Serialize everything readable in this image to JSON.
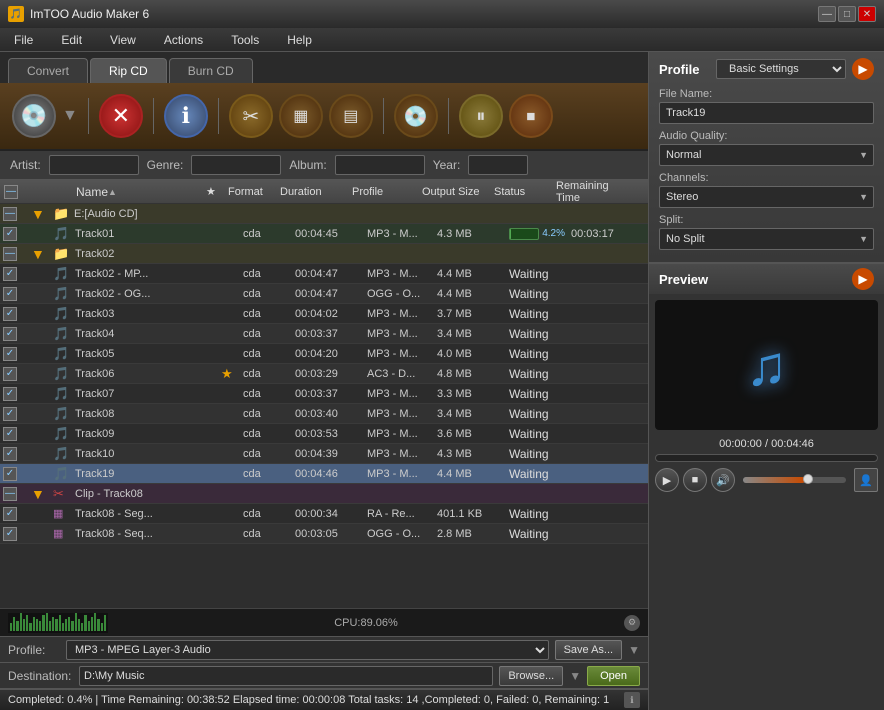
{
  "app": {
    "title": "ImTOO Audio Maker 6",
    "icon": "🎵"
  },
  "title_controls": {
    "minimize": "—",
    "maximize": "□",
    "close": "✕"
  },
  "menu": {
    "items": [
      "File",
      "Edit",
      "View",
      "Actions",
      "Tools",
      "Help"
    ]
  },
  "tabs": {
    "convert": "Convert",
    "rip_cd": "Rip CD",
    "burn_cd": "Burn CD",
    "active": "rip_cd"
  },
  "toolbar": {
    "buttons": [
      {
        "id": "disc",
        "label": "💿",
        "title": "Open Disc"
      },
      {
        "id": "delete",
        "label": "✕",
        "title": "Delete"
      },
      {
        "id": "info",
        "label": "ℹ",
        "title": "Info"
      },
      {
        "id": "scissors",
        "label": "✂",
        "title": "Cut"
      },
      {
        "id": "strip",
        "label": "🎞",
        "title": "Strip"
      },
      {
        "id": "film",
        "label": "🎬",
        "title": "Film"
      },
      {
        "id": "cd",
        "label": "💿",
        "title": "CD"
      },
      {
        "id": "pause",
        "label": "⏸",
        "title": "Pause"
      },
      {
        "id": "stop",
        "label": "⏹",
        "title": "Stop"
      }
    ]
  },
  "meta": {
    "artist_label": "Artist:",
    "artist_value": "",
    "genre_label": "Genre:",
    "genre_value": "",
    "album_label": "Album:",
    "album_value": "",
    "year_label": "Year:",
    "year_value": ""
  },
  "list_headers": {
    "check": "",
    "icon1": "",
    "icon2": "",
    "name": "Name",
    "star": "",
    "format": "Format",
    "duration": "Duration",
    "profile": "Profile",
    "output_size": "Output Size",
    "status": "Status",
    "remaining": "Remaining Time"
  },
  "file_list": {
    "items": [
      {
        "id": "drive",
        "indent": 0,
        "type": "drive",
        "name": "E:[Audio CD]",
        "format": "",
        "duration": "",
        "profile": "",
        "output_size": "",
        "status": "",
        "remaining": "",
        "checked": "partial"
      },
      {
        "id": "track01",
        "indent": 1,
        "type": "track",
        "name": "Track01",
        "format": "cda",
        "duration": "00:04:45",
        "profile": "MP3 - M...",
        "output_size": "4.3 MB",
        "status": "4.2%",
        "remaining": "00:03:17",
        "checked": "checked",
        "progress": 4.2
      },
      {
        "id": "group1",
        "indent": 1,
        "type": "group",
        "name": "Track02",
        "format": "",
        "duration": "",
        "profile": "",
        "output_size": "",
        "status": "",
        "remaining": "",
        "checked": "partial"
      },
      {
        "id": "track02mp3",
        "indent": 2,
        "type": "track",
        "name": "Track02 - MP...",
        "format": "cda",
        "duration": "00:04:47",
        "profile": "MP3 - M...",
        "output_size": "4.4 MB",
        "status": "Waiting",
        "remaining": "",
        "checked": "checked"
      },
      {
        "id": "track02ogg",
        "indent": 2,
        "type": "track",
        "name": "Track02 - OG...",
        "format": "cda",
        "duration": "00:04:47",
        "profile": "OGG - O...",
        "output_size": "4.4 MB",
        "status": "Waiting",
        "remaining": "",
        "checked": "checked"
      },
      {
        "id": "track03",
        "indent": 1,
        "type": "track",
        "name": "Track03",
        "format": "cda",
        "duration": "00:04:02",
        "profile": "MP3 - M...",
        "output_size": "3.7 MB",
        "status": "Waiting",
        "remaining": "",
        "checked": "checked"
      },
      {
        "id": "track04",
        "indent": 1,
        "type": "track",
        "name": "Track04",
        "format": "cda",
        "duration": "00:03:37",
        "profile": "MP3 - M...",
        "output_size": "3.4 MB",
        "status": "Waiting",
        "remaining": "",
        "checked": "checked"
      },
      {
        "id": "track05",
        "indent": 1,
        "type": "track",
        "name": "Track05",
        "format": "cda",
        "duration": "00:04:20",
        "profile": "MP3 - M...",
        "output_size": "4.0 MB",
        "status": "Waiting",
        "remaining": "",
        "checked": "checked"
      },
      {
        "id": "track06",
        "indent": 1,
        "type": "track",
        "name": "Track06",
        "format": "cda",
        "duration": "00:03:29",
        "profile": "AC3 - D...",
        "output_size": "4.8 MB",
        "status": "Waiting",
        "remaining": "",
        "checked": "checked",
        "star": true
      },
      {
        "id": "track07",
        "indent": 1,
        "type": "track",
        "name": "Track07",
        "format": "cda",
        "duration": "00:03:37",
        "profile": "MP3 - M...",
        "output_size": "3.3 MB",
        "status": "Waiting",
        "remaining": "",
        "checked": "checked"
      },
      {
        "id": "track08",
        "indent": 1,
        "type": "track",
        "name": "Track08",
        "format": "cda",
        "duration": "00:03:40",
        "profile": "MP3 - M...",
        "output_size": "3.4 MB",
        "status": "Waiting",
        "remaining": "",
        "checked": "checked"
      },
      {
        "id": "track09",
        "indent": 1,
        "type": "track",
        "name": "Track09",
        "format": "cda",
        "duration": "00:03:53",
        "profile": "MP3 - M...",
        "output_size": "3.6 MB",
        "status": "Waiting",
        "remaining": "",
        "checked": "checked"
      },
      {
        "id": "track10",
        "indent": 1,
        "type": "track",
        "name": "Track10",
        "format": "cda",
        "duration": "00:04:39",
        "profile": "MP3 - M...",
        "output_size": "4.3 MB",
        "status": "Waiting",
        "remaining": "",
        "checked": "checked"
      },
      {
        "id": "track19",
        "indent": 1,
        "type": "track",
        "name": "Track19",
        "format": "cda",
        "duration": "00:04:46",
        "profile": "MP3 - M...",
        "output_size": "4.4 MB",
        "status": "Waiting",
        "remaining": "",
        "checked": "checked",
        "selected": true
      },
      {
        "id": "clip_group",
        "indent": 0,
        "type": "group2",
        "name": "Clip - Track08",
        "format": "",
        "duration": "",
        "profile": "",
        "output_size": "",
        "status": "",
        "remaining": "",
        "checked": "partial"
      },
      {
        "id": "track08seg1",
        "indent": 1,
        "type": "segtrack",
        "name": "Track08 - Seg...",
        "format": "cda",
        "duration": "00:00:34",
        "profile": "RA - Re...",
        "output_size": "401.1 KB",
        "status": "Waiting",
        "remaining": "",
        "checked": "checked"
      },
      {
        "id": "track08seg2",
        "indent": 1,
        "type": "segtrack",
        "name": "Track08 - Seq...",
        "format": "cda",
        "duration": "00:03:05",
        "profile": "OGG - O...",
        "output_size": "2.8 MB",
        "status": "Waiting",
        "remaining": "",
        "checked": "checked"
      }
    ]
  },
  "waveform": {
    "cpu_text": "CPU:89.06%",
    "bars": [
      4,
      7,
      5,
      9,
      6,
      8,
      4,
      7,
      6,
      5,
      8,
      9,
      5,
      7,
      6,
      8,
      4,
      6,
      7,
      5,
      9,
      6,
      4,
      8,
      5,
      7,
      9,
      6,
      4,
      8
    ]
  },
  "profile_bar": {
    "label": "Profile:",
    "value": "MP3 - MPEG Layer-3 Audio",
    "save_as": "Save As...",
    "dropdown_arrow": "▼"
  },
  "dest_bar": {
    "label": "Destination:",
    "value": "D:\\My Music",
    "browse": "Browse...",
    "open": "Open"
  },
  "status_bar": {
    "text": "Completed: 0.4%  |  Time Remaining: 00:38:52  Elapsed time: 00:00:08  Total tasks: 14 ,Completed: 0, Failed: 0, Remaining: 1"
  },
  "right_panel": {
    "profile_title": "Profile",
    "basic_settings": "Basic Settings",
    "file_name_label": "File Name:",
    "file_name_value": "Track19",
    "audio_quality_label": "Audio Quality:",
    "audio_quality_value": "Normal",
    "channels_label": "Channels:",
    "channels_value": "Stereo",
    "split_label": "Split:",
    "split_value": "No Split",
    "preview_title": "Preview",
    "preview_time": "00:00:00 / 00:04:46",
    "play": "▶",
    "stop": "■",
    "volume": "🔊",
    "music_note": "♫"
  }
}
